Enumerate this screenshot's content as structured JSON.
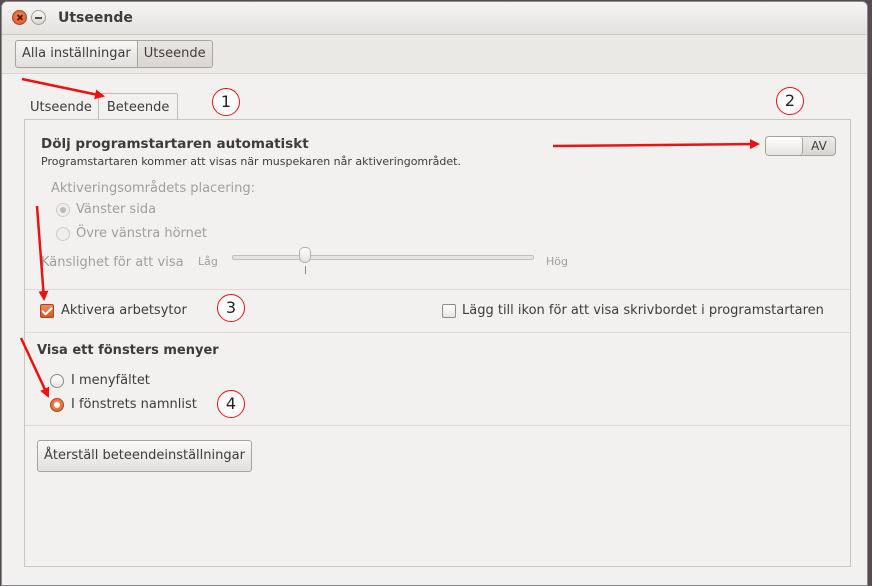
{
  "window": {
    "title": "Utseende"
  },
  "breadcrumb": [
    "Alla inställningar",
    "Utseende"
  ],
  "tabs": [
    {
      "label": "Utseende",
      "active": false
    },
    {
      "label": "Beteende",
      "active": true
    }
  ],
  "autohide": {
    "heading": "Dölj programstartaren automatiskt",
    "description": "Programstartaren kommer att visas när muspekaren når aktiveringområdet.",
    "switch_label": "AV",
    "enabled": false
  },
  "placement": {
    "label": "Aktiveringsområdets placering:",
    "options": [
      {
        "label": "Vänster sida",
        "selected": true
      },
      {
        "label": "Övre vänstra hörnet",
        "selected": false
      }
    ]
  },
  "sensitivity": {
    "label": "Känslighet för att visa",
    "low": "Låg",
    "high": "Hög",
    "value_fraction": 0.24
  },
  "workspaces": {
    "label": "Aktivera arbetsytor",
    "checked": true
  },
  "show_desktop": {
    "label": "Lägg till ikon för att visa skrivbordet i programstartaren",
    "checked": false
  },
  "menus": {
    "heading": "Visa ett fönsters menyer",
    "options": [
      {
        "label": "I menyfältet",
        "selected": false
      },
      {
        "label": "I fönstrets namnlist",
        "selected": true
      }
    ]
  },
  "reset_button": "Återställ beteendeinställningar",
  "annotations": [
    "1",
    "2",
    "3",
    "4"
  ],
  "colors": {
    "accent": "#dc5a24",
    "annotation": "#ee1111"
  }
}
